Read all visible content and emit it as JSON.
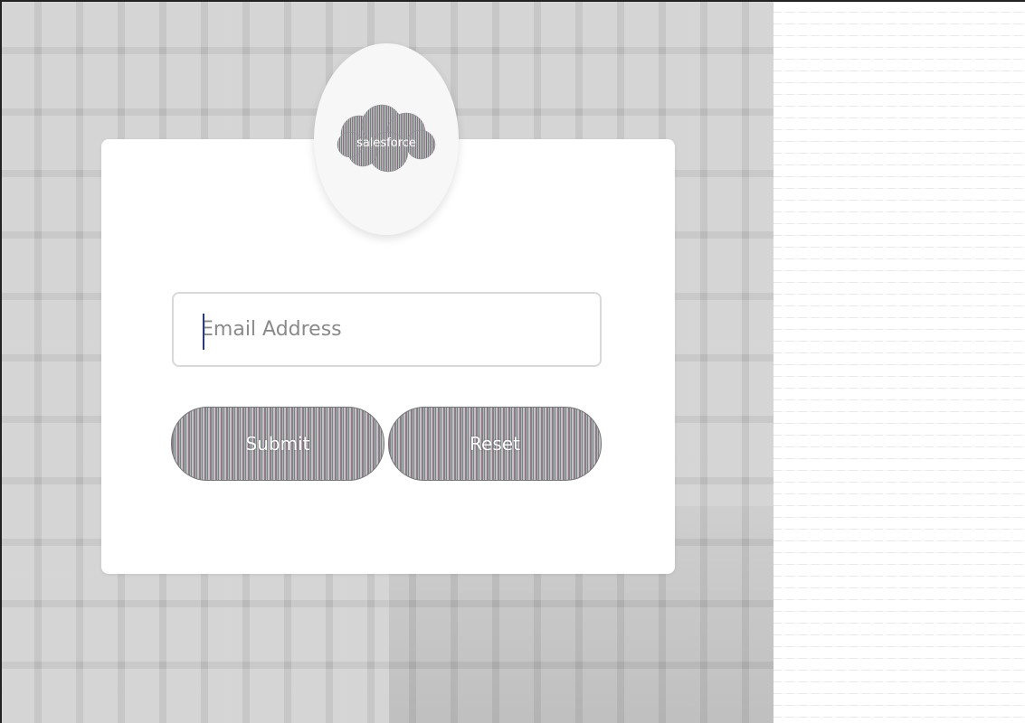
{
  "logo": {
    "brand_text": "salesforce",
    "icon": "salesforce-cloud-icon"
  },
  "form": {
    "email_placeholder": "Email Address",
    "email_value": ""
  },
  "buttons": {
    "submit_label": "Submit",
    "reset_label": "Reset"
  },
  "colors": {
    "background": "#cfcfcf",
    "card": "#ffffff",
    "field_border": "#d9d9d9",
    "cursor": "#2a3b7a"
  }
}
